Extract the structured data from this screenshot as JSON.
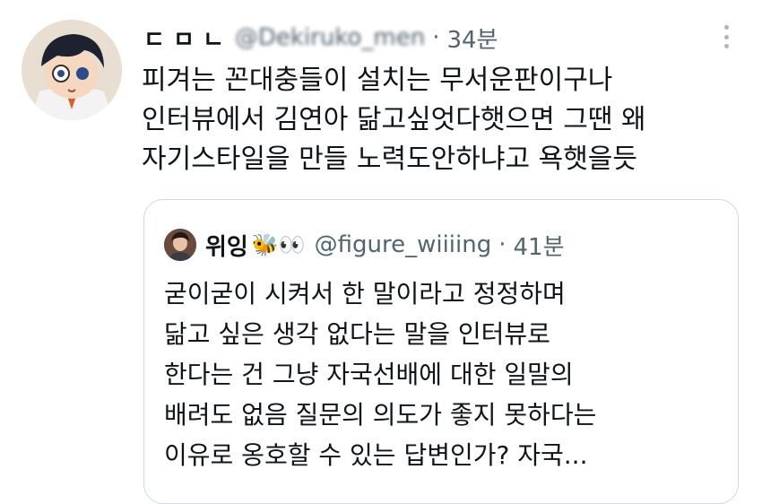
{
  "tweet": {
    "author_name": "ㄷ ㅁ ㄴ",
    "author_handle": "@Dekiruko_men",
    "separator": "·",
    "time": "34분",
    "lines": [
      "피겨는 꼰대충들이 설치는 무서운판이구나",
      "인터뷰에서 김연아 닮고싶엇다햇으면 그땐 왜",
      "자기스타일을 만들 노력도안하냐고 욕햇을듯"
    ]
  },
  "quoted": {
    "author_name": "위잉",
    "emoji": "🐝👀",
    "author_handle": "@figure_wiiiing",
    "separator": "·",
    "time": "41분",
    "lines": [
      "굳이굳이 시켜서 한 말이라고 정정하며",
      "닮고 싶은 생각 없다는 말을 인터뷰로",
      "한다는 건 그냥 자국선배에 대한 일말의",
      "배려도 없음 질문의 의도가 좋지 못하다는",
      "이유로 옹호할 수 있는 답변인가? 자국..."
    ]
  },
  "icons": {
    "avatar": "anime-boy-avatar",
    "more": "more-options-icon",
    "quoted_avatar": "user-photo-avatar"
  }
}
